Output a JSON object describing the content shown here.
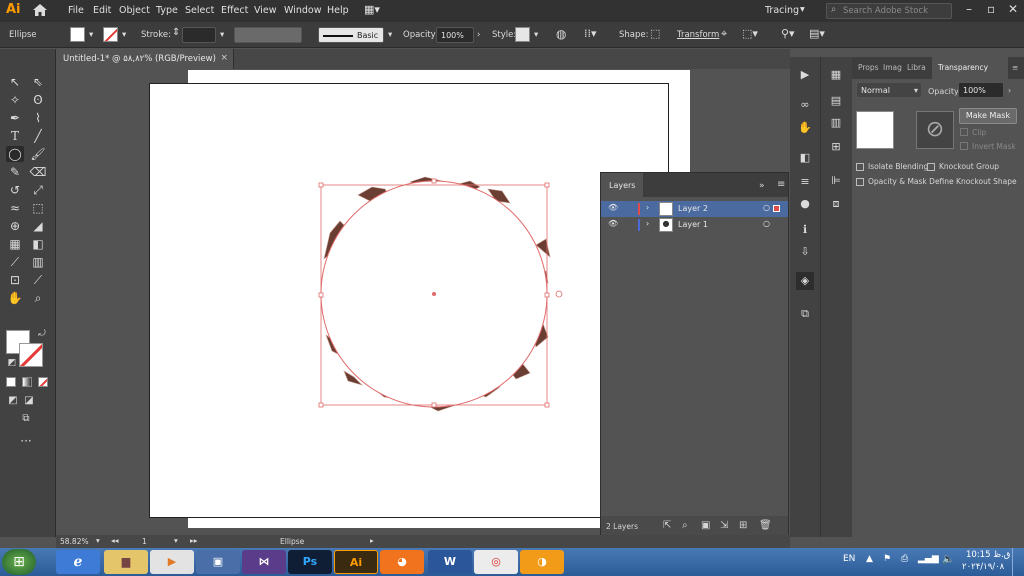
{
  "app": {
    "logo": "Ai"
  },
  "menu": [
    "File",
    "Edit",
    "Object",
    "Type",
    "Select",
    "Effect",
    "View",
    "Window",
    "Help"
  ],
  "workspace": "Tracing",
  "search": {
    "placeholder": "Search Adobe Stock"
  },
  "control": {
    "selection": "Ellipse",
    "stroke_label": "Stroke:",
    "brush": "Basic",
    "opacity_label": "Opacity:",
    "opacity": "100%",
    "style_label": "Style:",
    "shape_label": "Shape:",
    "transform_label": "Transform"
  },
  "document": {
    "tab": "Untitled-1* @ ۵۸,۸۲% (RGB/Preview)",
    "close": "×"
  },
  "layers": {
    "title": "Layers",
    "rows": [
      {
        "name": "Layer 2",
        "selected": true,
        "color": "#e04b4b"
      },
      {
        "name": "Layer 1",
        "selected": false,
        "color": "#4b6ad8"
      }
    ],
    "count": "2 Layers"
  },
  "transparency": {
    "tabs": [
      "Props",
      "Imag",
      "Libra",
      "Transparency"
    ],
    "blend": "Normal",
    "opacity_label": "Opacity:",
    "opacity": "100%",
    "make_mask": "Make Mask",
    "clip": "Clip",
    "invert": "Invert Mask",
    "isolate": "Isolate Blending",
    "knockout": "Knockout Group",
    "define": "Opacity & Mask Define Knockout Shape"
  },
  "status": {
    "zoom": "58.82%",
    "page": "1",
    "tool": "Ellipse"
  },
  "taskbar": {
    "lang": "EN",
    "time": "10:15 ق.ظ",
    "date": "۲۰۲۴/۱۹/۰۸"
  },
  "colors": {
    "selection": "#e06a6a",
    "accent": "#ff9a00"
  }
}
